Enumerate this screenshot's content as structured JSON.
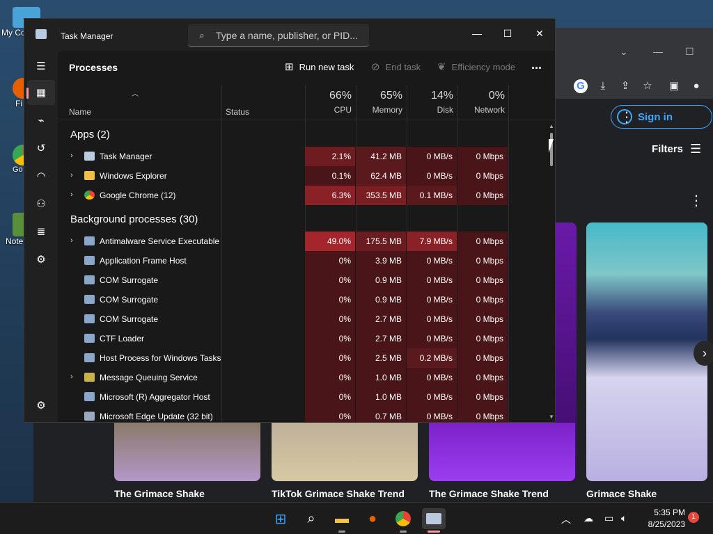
{
  "desktop": {
    "icons": [
      {
        "label": "My Co",
        "color": "#4aa3d8"
      },
      {
        "label": "Fi",
        "color": "#e66000"
      },
      {
        "label": "Go Chr",
        "color": "#34a853"
      },
      {
        "label": "Note",
        "color": "#5a8f3a"
      }
    ]
  },
  "browser": {
    "sign_in_label": "Sign in",
    "filters_label": "Filters",
    "videos": [
      {
        "title": "The Grimace Shake"
      },
      {
        "title": "TikTok Grimace Shake Trend"
      },
      {
        "title": "The Grimace Shake Trend"
      },
      {
        "title": "Grimace Shake"
      }
    ]
  },
  "task_manager": {
    "title": "Task Manager",
    "search_placeholder": "Type a name, publisher, or PID...",
    "page_title": "Processes",
    "toolbar": {
      "run_new_task": "Run new task",
      "end_task": "End task",
      "efficiency_mode": "Efficiency mode",
      "more": "..."
    },
    "headers": {
      "name": "Name",
      "status": "Status",
      "cpu_pct": "66%",
      "cpu": "CPU",
      "memory_pct": "65%",
      "memory": "Memory",
      "disk_pct": "14%",
      "disk": "Disk",
      "network_pct": "0%",
      "network": "Network"
    },
    "groups": {
      "apps": "Apps (2)",
      "background": "Background processes (30)"
    },
    "apps": [
      {
        "name": "Task Manager",
        "cpu": "2.1%",
        "memory": "41.2 MB",
        "disk": "0 MB/s",
        "network": "0 Mbps"
      },
      {
        "name": "Windows Explorer",
        "cpu": "0.1%",
        "memory": "62.4 MB",
        "disk": "0 MB/s",
        "network": "0 Mbps"
      },
      {
        "name": "Google Chrome (12)",
        "cpu": "6.3%",
        "memory": "353.5 MB",
        "disk": "0.1 MB/s",
        "network": "0 Mbps"
      }
    ],
    "background": [
      {
        "name": "Antimalware Service Executable",
        "cpu": "49.0%",
        "memory": "175.5 MB",
        "disk": "7.9 MB/s",
        "network": "0 Mbps"
      },
      {
        "name": "Application Frame Host",
        "cpu": "0%",
        "memory": "3.9 MB",
        "disk": "0 MB/s",
        "network": "0 Mbps"
      },
      {
        "name": "COM Surrogate",
        "cpu": "0%",
        "memory": "0.9 MB",
        "disk": "0 MB/s",
        "network": "0 Mbps"
      },
      {
        "name": "COM Surrogate",
        "cpu": "0%",
        "memory": "0.9 MB",
        "disk": "0 MB/s",
        "network": "0 Mbps"
      },
      {
        "name": "COM Surrogate",
        "cpu": "0%",
        "memory": "2.7 MB",
        "disk": "0 MB/s",
        "network": "0 Mbps"
      },
      {
        "name": "CTF Loader",
        "cpu": "0%",
        "memory": "2.7 MB",
        "disk": "0 MB/s",
        "network": "0 Mbps"
      },
      {
        "name": "Host Process for Windows Tasks",
        "cpu": "0%",
        "memory": "2.5 MB",
        "disk": "0.2 MB/s",
        "network": "0 Mbps"
      },
      {
        "name": "Message Queuing Service",
        "cpu": "0%",
        "memory": "1.0 MB",
        "disk": "0 MB/s",
        "network": "0 Mbps"
      },
      {
        "name": "Microsoft (R) Aggregator Host",
        "cpu": "0%",
        "memory": "1.0 MB",
        "disk": "0 MB/s",
        "network": "0 Mbps"
      },
      {
        "name": "Microsoft Edge Update (32 bit)",
        "cpu": "0%",
        "memory": "0.7 MB",
        "disk": "0 MB/s",
        "network": "0 Mbps"
      }
    ]
  },
  "taskbar": {
    "time": "5:35 PM",
    "date": "8/25/2023",
    "notification_count": "1"
  },
  "colors": {
    "heat_high": "#a4262c",
    "heat_mid": "#7a1e22",
    "heat_low": "#4a1518",
    "accent": "#ff99a4"
  }
}
